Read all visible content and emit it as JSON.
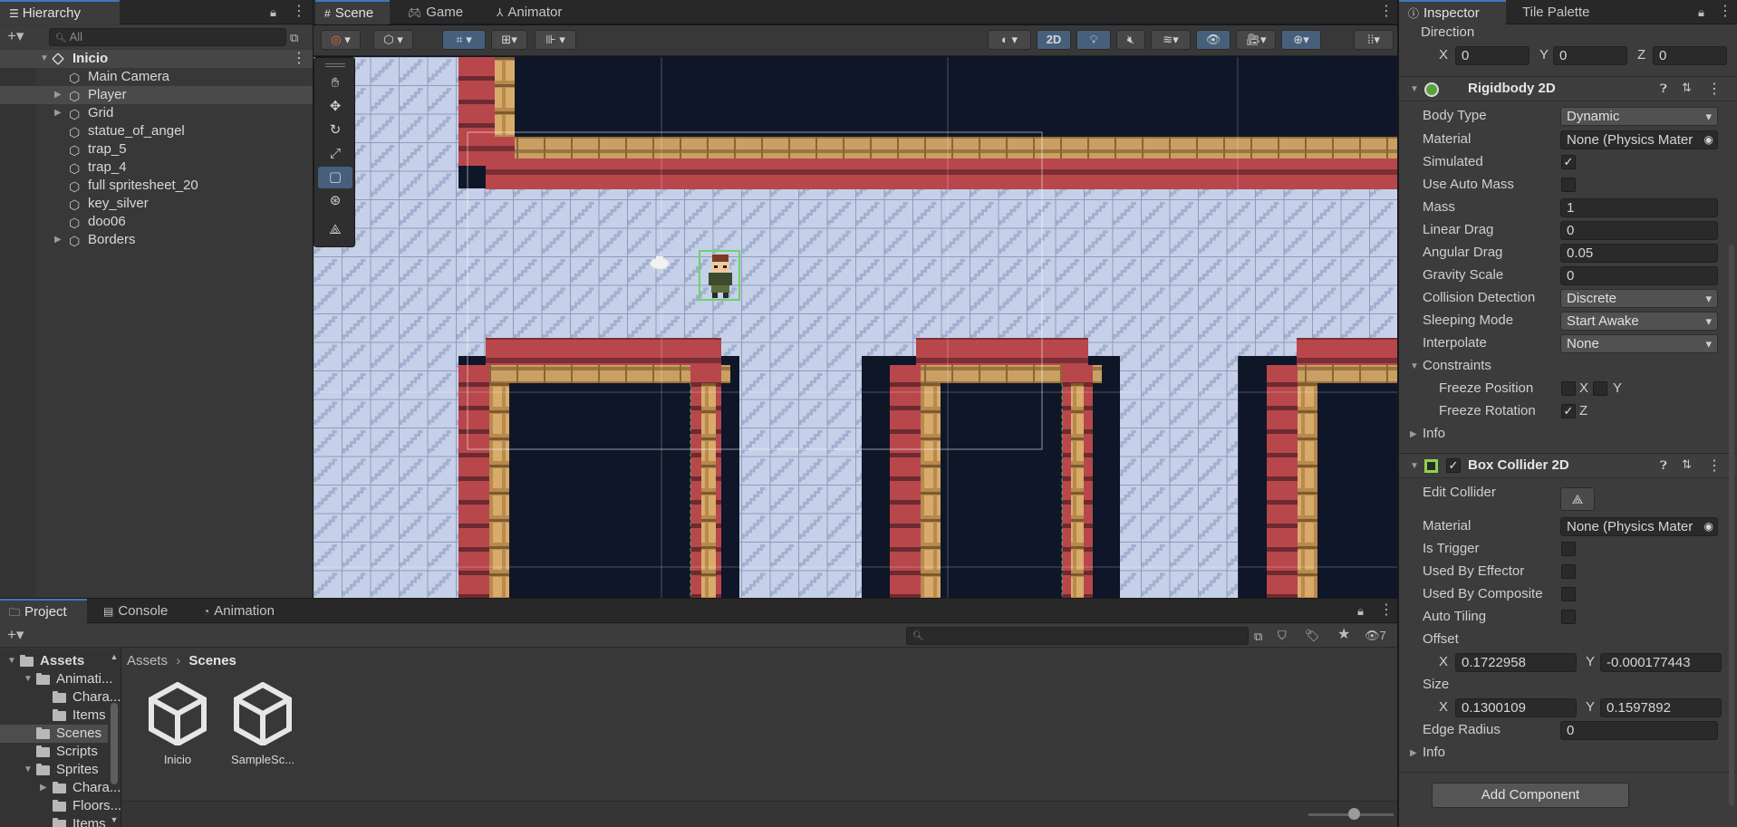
{
  "hierarchy": {
    "tab": "Hierarchy",
    "search_placeholder": "All",
    "scene": "Inicio",
    "items": [
      {
        "label": "Main Camera",
        "expandable": false
      },
      {
        "label": "Player",
        "expandable": true
      },
      {
        "label": "Grid",
        "expandable": true
      },
      {
        "label": "statue_of_angel",
        "expandable": false
      },
      {
        "label": "trap_5",
        "expandable": false
      },
      {
        "label": "trap_4",
        "expandable": false
      },
      {
        "label": "full spritesheet_20",
        "expandable": false
      },
      {
        "label": "key_silver",
        "expandable": false
      },
      {
        "label": "doo06",
        "expandable": false
      },
      {
        "label": "Borders",
        "expandable": true
      }
    ]
  },
  "scene_tabs": {
    "scene": "Scene",
    "game": "Game",
    "animator": "Animator"
  },
  "scene_toolbar": {
    "mode_2d": "2D"
  },
  "project": {
    "tabs": {
      "project": "Project",
      "console": "Console",
      "animation": "Animation"
    },
    "hidden_count": "7",
    "breadcrumb": {
      "root": "Assets",
      "current": "Scenes"
    },
    "tree": [
      {
        "label": "Assets",
        "indent": 0,
        "expanded": true
      },
      {
        "label": "Animati...",
        "indent": 1,
        "expanded": true
      },
      {
        "label": "Chara...",
        "indent": 2,
        "expanded": false
      },
      {
        "label": "Items",
        "indent": 2,
        "expanded": false
      },
      {
        "label": "Scenes",
        "indent": 1,
        "expanded": false
      },
      {
        "label": "Scripts",
        "indent": 1,
        "expanded": false
      },
      {
        "label": "Sprites",
        "indent": 1,
        "expanded": true
      },
      {
        "label": "Chara...",
        "indent": 2,
        "expanded": false
      },
      {
        "label": "Floors...",
        "indent": 2,
        "expanded": false
      },
      {
        "label": "Items",
        "indent": 2,
        "expanded": false
      }
    ],
    "assets": [
      {
        "label": "Inicio"
      },
      {
        "label": "SampleSc..."
      }
    ]
  },
  "inspector": {
    "tabs": {
      "inspector": "Inspector",
      "tile_palette": "Tile Palette"
    },
    "direction": {
      "label": "Direction",
      "x": "0",
      "y": "0",
      "z": "0"
    },
    "rigidbody": {
      "title": "Rigidbody 2D",
      "body_type": {
        "label": "Body Type",
        "value": "Dynamic"
      },
      "material": {
        "label": "Material",
        "value": "None (Physics Mater"
      },
      "simulated": {
        "label": "Simulated",
        "checked": true
      },
      "use_auto_mass": {
        "label": "Use Auto Mass",
        "checked": false
      },
      "mass": {
        "label": "Mass",
        "value": "1"
      },
      "linear_drag": {
        "label": "Linear Drag",
        "value": "0"
      },
      "angular_drag": {
        "label": "Angular Drag",
        "value": "0.05"
      },
      "gravity_scale": {
        "label": "Gravity Scale",
        "value": "0"
      },
      "collision_detection": {
        "label": "Collision Detection",
        "value": "Discrete"
      },
      "sleeping_mode": {
        "label": "Sleeping Mode",
        "value": "Start Awake"
      },
      "interpolate": {
        "label": "Interpolate",
        "value": "None"
      },
      "constraints": "Constraints",
      "freeze_position": {
        "label": "Freeze Position",
        "x": "X",
        "y": "Y"
      },
      "freeze_rotation": {
        "label": "Freeze Rotation",
        "z": "Z"
      },
      "info": "Info"
    },
    "box_collider": {
      "title": "Box Collider 2D",
      "edit_collider": "Edit Collider",
      "material": {
        "label": "Material",
        "value": "None (Physics Mater"
      },
      "is_trigger": "Is Trigger",
      "used_by_effector": "Used By Effector",
      "used_by_composite": "Used By Composite",
      "auto_tiling": "Auto Tiling",
      "offset": {
        "label": "Offset",
        "x": "0.1722958",
        "y": "-0.000177443"
      },
      "size": {
        "label": "Size",
        "x": "0.1300109",
        "y": "0.1597892"
      },
      "edge_radius": {
        "label": "Edge Radius",
        "value": "0"
      },
      "info": "Info"
    },
    "add_component": "Add Component"
  },
  "colors": {
    "accent": "#3a79bb",
    "panel": "#383838",
    "tabbar": "#282828",
    "selected_row": "#4d4d4d",
    "wall_red": "#b04a4e",
    "floor": "#c3cde6",
    "void": "#0f1628"
  }
}
